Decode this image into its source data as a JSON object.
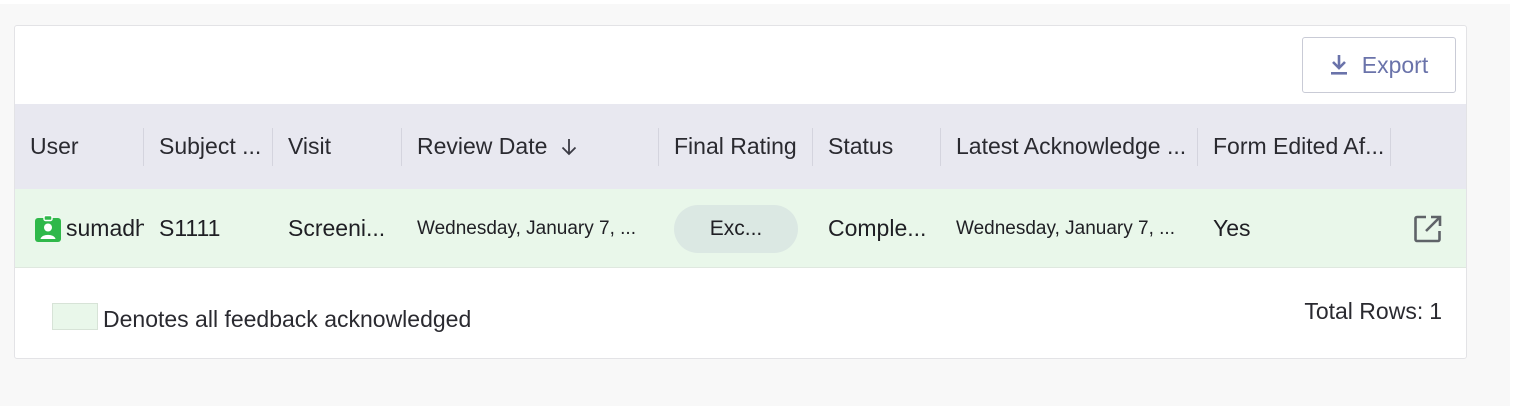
{
  "toolbar": {
    "export_label": "Export"
  },
  "table": {
    "columns": [
      "User",
      "Subject ...",
      "Visit",
      "Review Date",
      "Final Rating",
      "Status",
      "Latest Acknowledge ...",
      "Form Edited Af..."
    ],
    "rows": [
      {
        "user": "sumadh",
        "subject": "S1111",
        "visit": "Screeni...",
        "review_date": "Wednesday, January 7, ...",
        "final_rating": "Exc...",
        "status": "Comple...",
        "latest_acknowledged": "Wednesday, January 7, ...",
        "form_edited_after": "Yes"
      }
    ]
  },
  "legend": {
    "text": "Denotes all feedback acknowledged",
    "color": "#e9f7ea"
  },
  "footer": {
    "total_rows_label": "Total Rows:",
    "total_rows_value": "1"
  },
  "icons": {
    "export": "download-icon",
    "sort": "arrow-down-icon",
    "user": "user-badge-icon",
    "open": "open-external-icon"
  },
  "colors": {
    "accent": "#6a73aa",
    "header_bg": "#e8e8f0",
    "user_icon": "#2fb84a"
  }
}
